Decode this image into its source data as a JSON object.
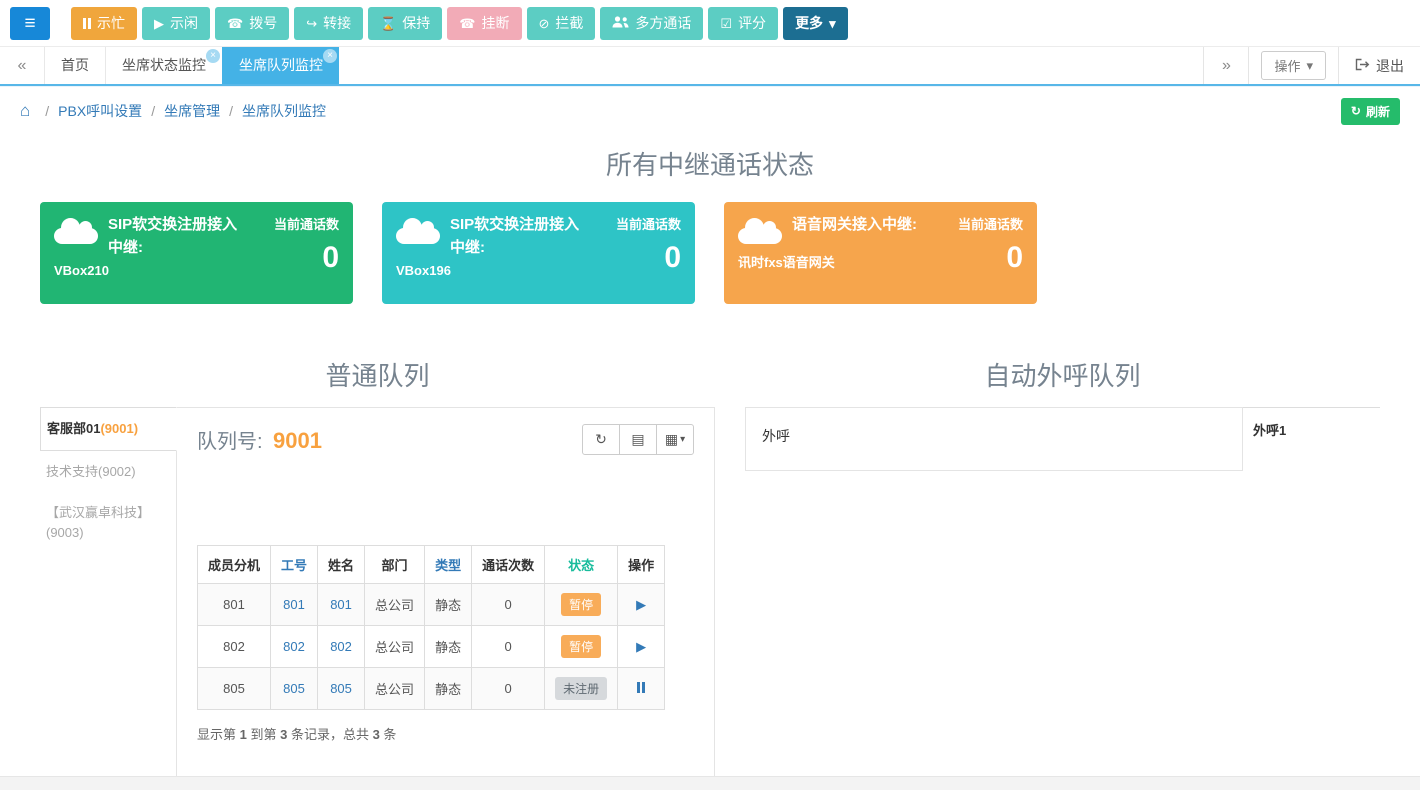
{
  "colors": {
    "menu_blue": "#1788d8",
    "toolbar_orange": "#f0a63c",
    "toolbar_teal": "#5ccdc3",
    "toolbar_pink": "#f2abb7",
    "toolbar_dark_blue": "#1c6e92",
    "active_tab_blue": "#44b2e6",
    "link_blue": "#337ab7",
    "refresh_green": "#25bc6b",
    "card_green": "#21b573",
    "card_teal": "#2ec4c6",
    "card_orange": "#f6a54c",
    "queue_number_orange": "#f8a13f",
    "badge_paused_orange": "#f8ac59",
    "badge_unregistered_gray": "#d6d9dc",
    "status_header_green": "#18bc9c"
  },
  "toolbar": {
    "buttons": [
      {
        "label": "示忙",
        "icon": "pause-icon"
      },
      {
        "label": "示闲",
        "icon": "play-icon"
      },
      {
        "label": "拨号",
        "icon": "phone-icon"
      },
      {
        "label": "转接",
        "icon": "transfer-icon"
      },
      {
        "label": "保持",
        "icon": "hourglass-icon"
      },
      {
        "label": "挂断",
        "icon": "hangup-icon"
      },
      {
        "label": "拦截",
        "icon": "block-icon"
      },
      {
        "label": "多方通话",
        "icon": "users-icon"
      },
      {
        "label": "评分",
        "icon": "check-icon"
      },
      {
        "label": "更多",
        "icon": "caret-down-icon"
      }
    ]
  },
  "tabbar": {
    "prev_icon": "«",
    "next_icon": "»",
    "tabs": [
      {
        "label": "首页"
      },
      {
        "label": "坐席状态监控"
      },
      {
        "label": "坐席队列监控"
      }
    ],
    "operation_label": "操作",
    "logout_label": "退出"
  },
  "breadcrumb": {
    "items": [
      "PBX呼叫设置",
      "坐席管理",
      "坐席队列监控"
    ],
    "refresh_label": "刷新"
  },
  "trunk_section": {
    "title": "所有中继通话状态",
    "cards": [
      {
        "title": "SIP软交换注册接入中继:",
        "name": "VBox210",
        "metric_label": "当前通话数",
        "metric_value": "0",
        "color": "#21b573"
      },
      {
        "title": "SIP软交换注册接入中继:",
        "name": "VBox196",
        "metric_label": "当前通话数",
        "metric_value": "0",
        "color": "#2ec4c6"
      },
      {
        "title": "语音网关接入中继:",
        "name": "讯时fxs语音网关",
        "metric_label": "当前通话数",
        "metric_value": "0",
        "color": "#f6a54c"
      }
    ]
  },
  "normal_queue": {
    "title": "普通队列",
    "tabs": [
      {
        "label": "客服部01",
        "number": "(9001)",
        "active": true
      },
      {
        "label": "技术支持",
        "number": "(9002)",
        "active": false
      },
      {
        "label": "【武汉赢卓科技】",
        "number": "(9003)",
        "active": false
      }
    ],
    "queue_label": "队列号:",
    "queue_number": "9001",
    "table": {
      "headers": [
        "成员分机",
        "工号",
        "姓名",
        "部门",
        "类型",
        "通话次数",
        "状态",
        "操作"
      ],
      "rows": [
        {
          "ext": "801",
          "worker_id": "801",
          "name": "801",
          "dept": "总公司",
          "type": "静态",
          "calls": "0",
          "status": "暂停",
          "status_type": "paused",
          "action": "play"
        },
        {
          "ext": "802",
          "worker_id": "802",
          "name": "802",
          "dept": "总公司",
          "type": "静态",
          "calls": "0",
          "status": "暂停",
          "status_type": "paused",
          "action": "play"
        },
        {
          "ext": "805",
          "worker_id": "805",
          "name": "805",
          "dept": "总公司",
          "type": "静态",
          "calls": "0",
          "status": "未注册",
          "status_type": "unregistered",
          "action": "pause"
        }
      ],
      "footer_parts": [
        "显示第 ",
        "1",
        " 到第 ",
        "3",
        " 条记录，总共 ",
        "3",
        " 条"
      ]
    }
  },
  "outbound_queue": {
    "title": "自动外呼队列",
    "panel_label": "外呼",
    "tab_label": "外呼1"
  }
}
